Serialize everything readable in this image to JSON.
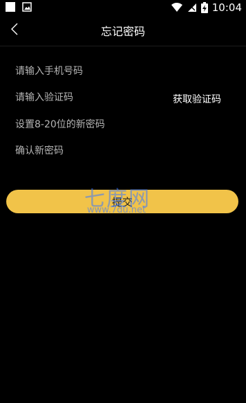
{
  "status_bar": {
    "time": "10:04",
    "icons": [
      "notification-square-icon",
      "image-icon",
      "wifi-icon",
      "signal-icon",
      "battery-charging-icon"
    ]
  },
  "header": {
    "title": "忘记密码",
    "back_icon": "chevron-left-icon"
  },
  "form": {
    "phone_placeholder": "请输入手机号码",
    "code_placeholder": "请输入验证码",
    "get_code_label": "获取验证码",
    "new_password_placeholder": "设置8-20位的新密码",
    "confirm_password_placeholder": "确认新密码",
    "submit_label": "提交"
  },
  "watermark": {
    "text": "七度网",
    "url": "www.7du.net"
  },
  "colors": {
    "background": "#000000",
    "accent": "#f1c349",
    "placeholder": "#b5b5b5",
    "watermark": "#3c78ff"
  }
}
